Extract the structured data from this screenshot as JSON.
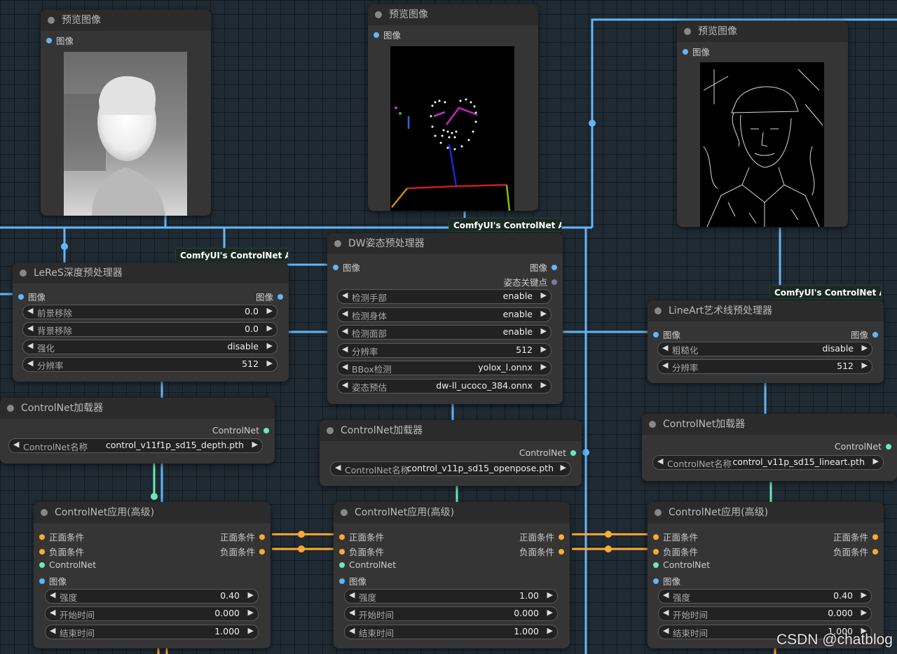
{
  "colors": {
    "image_link": "#64b5f6",
    "conditioning_link": "#ffa931",
    "controlnet_link": "#6ee7b7",
    "node_bg": "#353535",
    "node_title_bg": "#2b2b2b",
    "canvas_bg": "#1f2a33"
  },
  "preview_nodes": [
    {
      "title": "预览图像",
      "input": "图像",
      "image": "depth-map-preview"
    },
    {
      "title": "预览图像",
      "input": "图像",
      "image": "openpose-skeleton-preview"
    },
    {
      "title": "预览图像",
      "input": "图像",
      "image": "lineart-preview"
    }
  ],
  "badges": [
    "ComfyUI's ControlNet Au..",
    "ComfyUI's ControlNet Au..",
    "ComfyUI's ControlNet Au.."
  ],
  "leres": {
    "title": "LeReS深度预处理器",
    "input": "图像",
    "output": "图像",
    "widgets": [
      {
        "label": "前景移除",
        "value": "0.0"
      },
      {
        "label": "背景移除",
        "value": "0.0"
      },
      {
        "label": "强化",
        "value": "disable"
      },
      {
        "label": "分辨率",
        "value": "512"
      }
    ]
  },
  "dwpose": {
    "title": "DW姿态预处理器",
    "input": "图像",
    "outputs": [
      "图像",
      "姿态关键点"
    ],
    "widgets": [
      {
        "label": "检测手部",
        "value": "enable"
      },
      {
        "label": "检测身体",
        "value": "enable"
      },
      {
        "label": "检测面部",
        "value": "enable"
      },
      {
        "label": "分辨率",
        "value": "512"
      },
      {
        "label": "BBox检测",
        "value": "yolox_l.onnx"
      },
      {
        "label": "姿态预估",
        "value": "dw-ll_ucoco_384.onnx"
      }
    ]
  },
  "lineart": {
    "title": "LineArt艺术线预处理器",
    "input": "图像",
    "output": "图像",
    "widgets": [
      {
        "label": "粗糙化",
        "value": "disable"
      },
      {
        "label": "分辨率",
        "value": "512"
      }
    ]
  },
  "loaders": [
    {
      "title": "ControlNet加载器",
      "output": "ControlNet",
      "label": "ControlNet名称",
      "value": "control_v11f1p_sd15_depth.pth"
    },
    {
      "title": "ControlNet加载器",
      "output": "ControlNet",
      "label": "ControlNet名称",
      "value": "control_v11p_sd15_openpose.pth"
    },
    {
      "title": "ControlNet加载器",
      "output": "ControlNet",
      "label": "ControlNet名称",
      "value": "control_v11p_sd15_lineart.pth"
    }
  ],
  "appliers": [
    {
      "title": "ControlNet应用(高级)",
      "inputs": [
        "正面条件",
        "负面条件",
        "ControlNet",
        "图像"
      ],
      "outputs": [
        "正面条件",
        "负面条件"
      ],
      "widgets": [
        {
          "label": "强度",
          "value": "0.40"
        },
        {
          "label": "开始时间",
          "value": "0.000"
        },
        {
          "label": "结束时间",
          "value": "1.000"
        }
      ]
    },
    {
      "title": "ControlNet应用(高级)",
      "inputs": [
        "正面条件",
        "负面条件",
        "ControlNet",
        "图像"
      ],
      "outputs": [
        "正面条件",
        "负面条件"
      ],
      "widgets": [
        {
          "label": "强度",
          "value": "1.00"
        },
        {
          "label": "开始时间",
          "value": "0.000"
        },
        {
          "label": "结束时间",
          "value": "1.000"
        }
      ]
    },
    {
      "title": "ControlNet应用(高级)",
      "inputs": [
        "正面条件",
        "负面条件",
        "ControlNet",
        "图像"
      ],
      "outputs": [
        "正面条件",
        "负面条件"
      ],
      "widgets": [
        {
          "label": "强度",
          "value": "0.40"
        },
        {
          "label": "开始时间",
          "value": "0.000"
        },
        {
          "label": "结束时间",
          "value": "1.000"
        }
      ]
    }
  ],
  "watermark": "CSDN @chatblog"
}
